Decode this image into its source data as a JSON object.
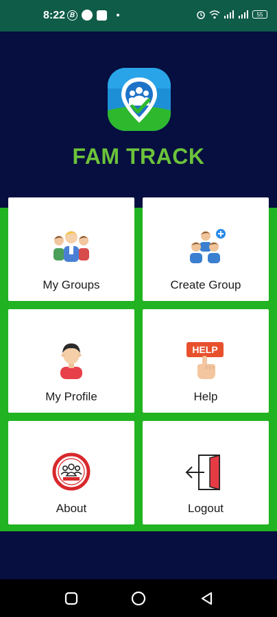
{
  "status_bar": {
    "time": "8:22",
    "icons": [
      "b-circle-icon",
      "dot-icon",
      "square-icon",
      "small-dot-icon",
      "alarm-icon",
      "wifi-icon",
      "signal-icon",
      "signal-icon",
      "battery-icon"
    ],
    "battery": "55"
  },
  "app": {
    "title": "FAM TRACK",
    "logo_icon": "family-location-pin-icon"
  },
  "menu": {
    "items": [
      {
        "label": "My Groups",
        "icon": "group-people-icon"
      },
      {
        "label": "Create Group",
        "icon": "create-group-icon"
      },
      {
        "label": "My Profile",
        "icon": "profile-person-icon"
      },
      {
        "label": "Help",
        "icon": "help-hand-icon",
        "badge": "HELP"
      },
      {
        "label": "About",
        "icon": "about-badge-icon"
      },
      {
        "label": "Logout",
        "icon": "logout-door-icon"
      }
    ]
  },
  "nav": {
    "buttons": [
      "recents-square-icon",
      "home-circle-icon",
      "back-triangle-icon"
    ]
  },
  "colors": {
    "background": "#060f3f",
    "accent_green": "#21b321",
    "title_green": "#6cc33a",
    "status_bar": "#0f5c48"
  }
}
